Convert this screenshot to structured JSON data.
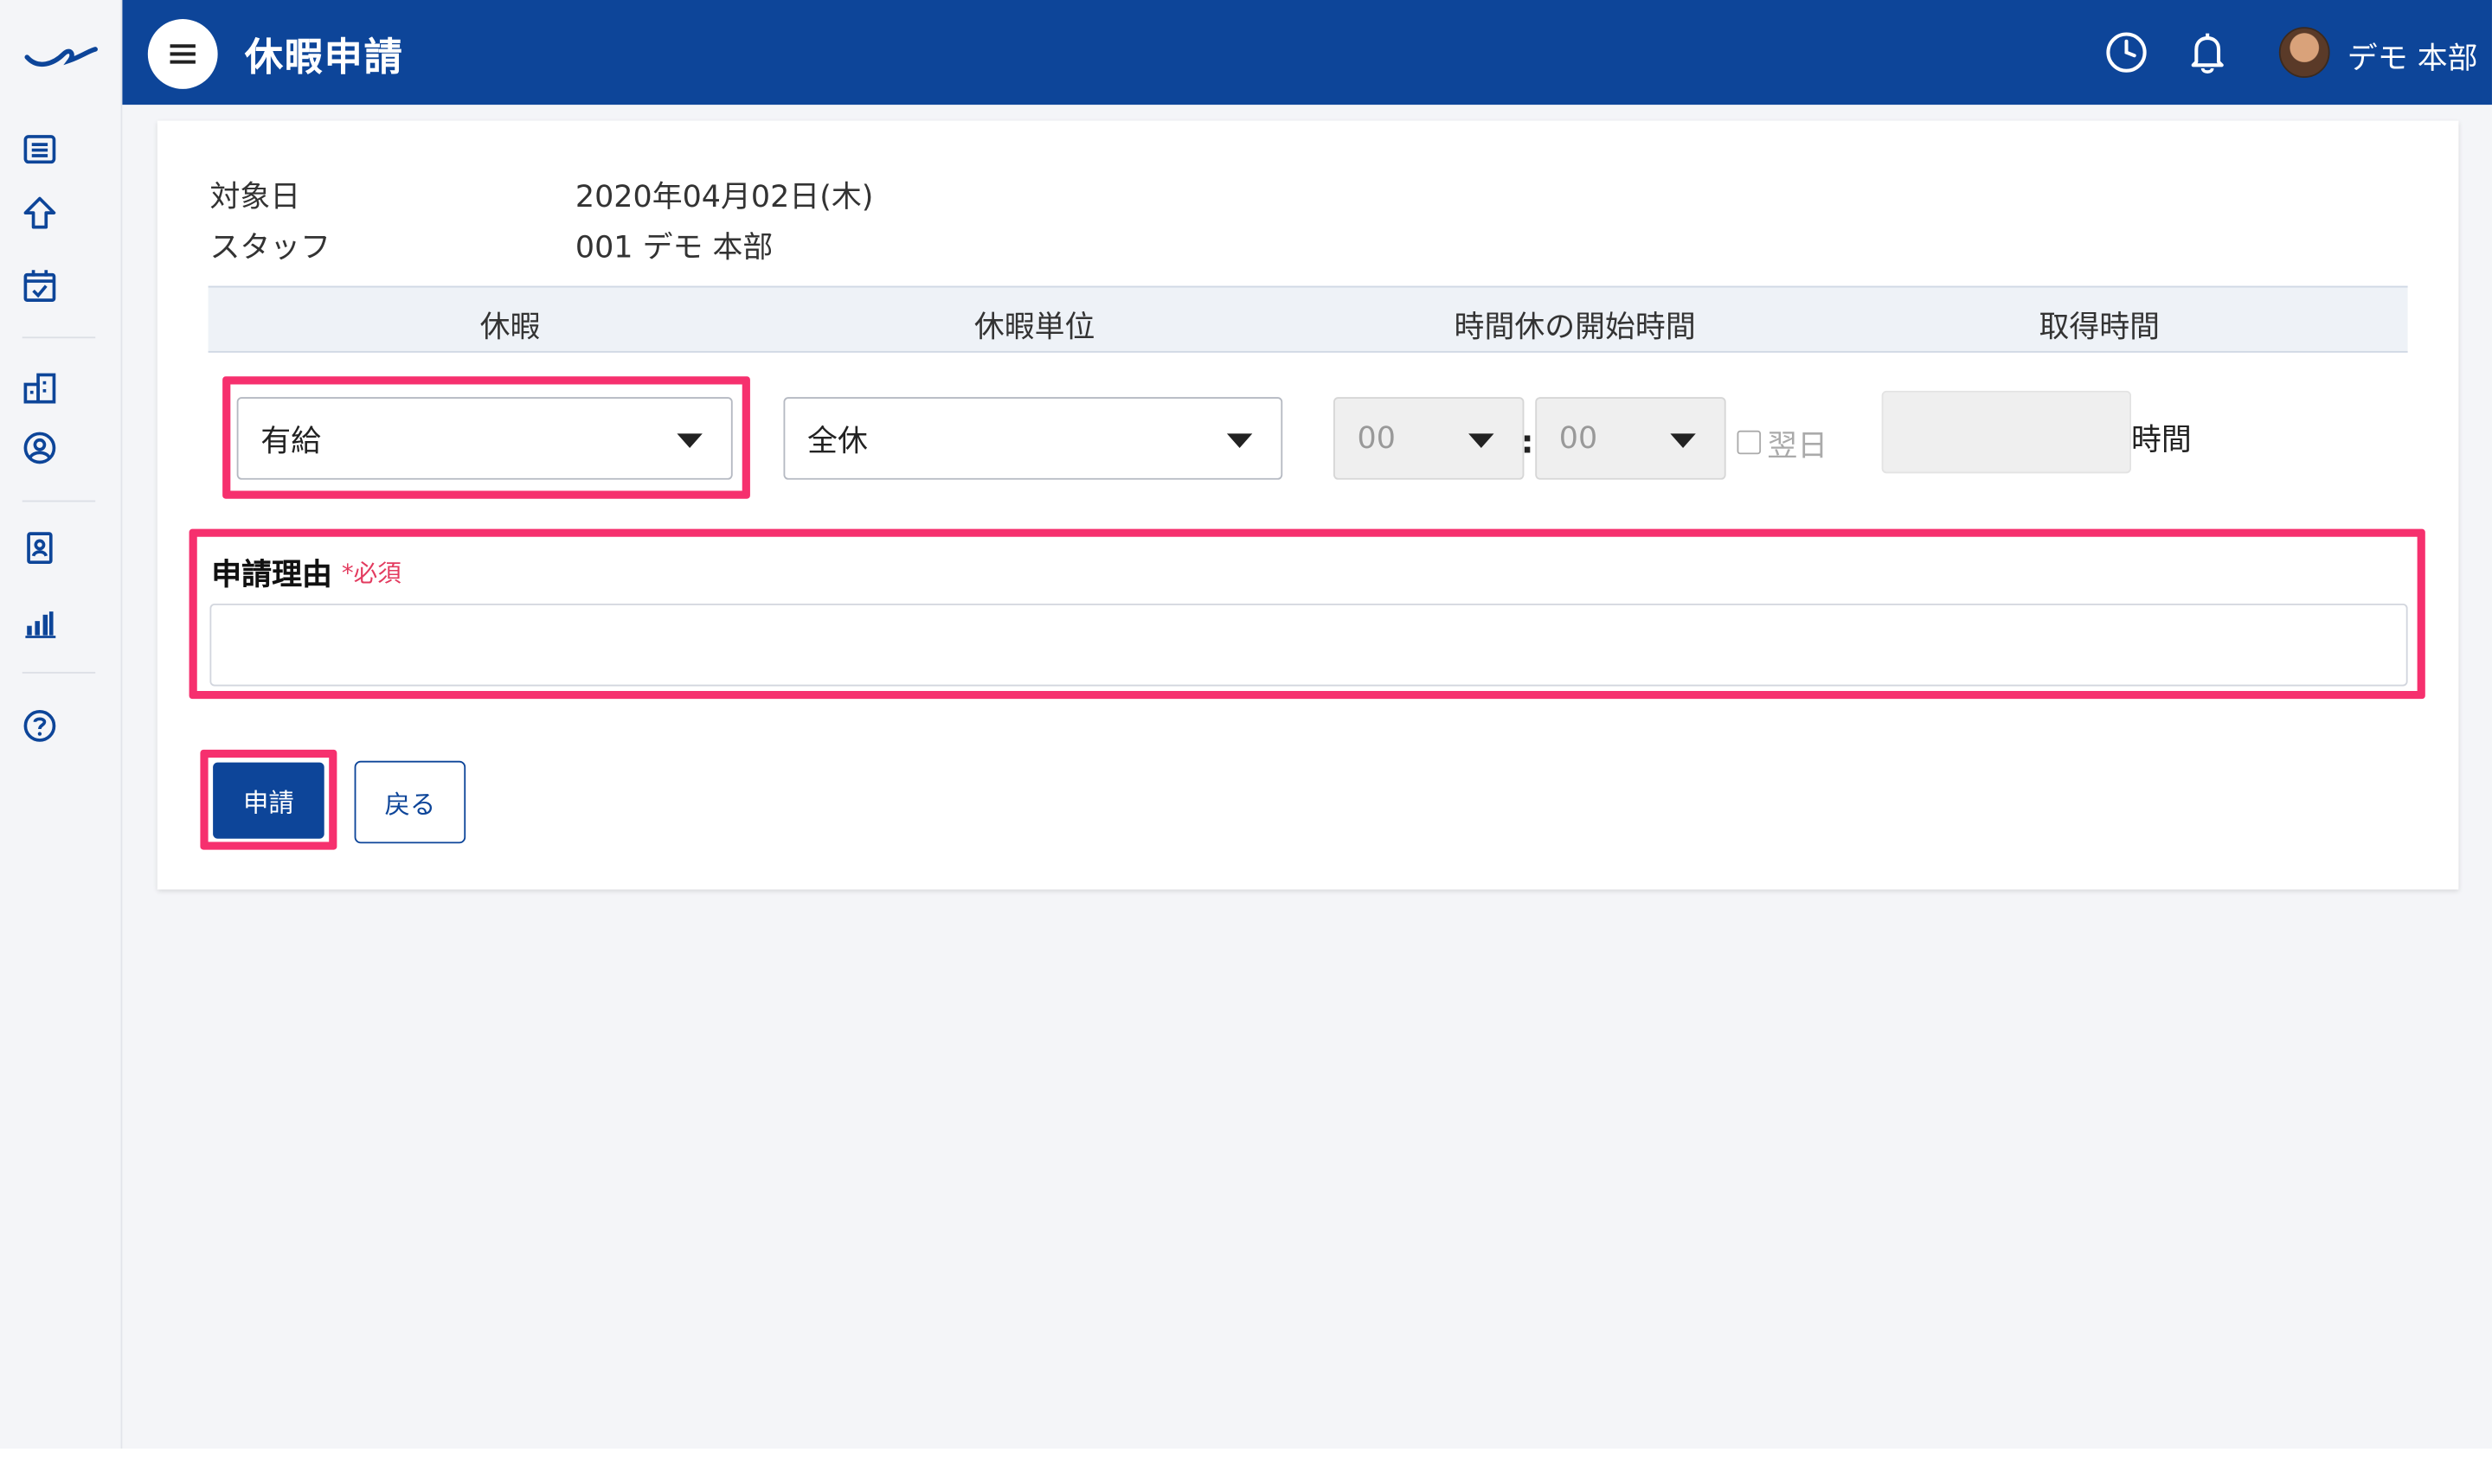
{
  "header": {
    "title": "休暇申請",
    "user_name": "デモ 本部"
  },
  "info": {
    "date_label": "対象日",
    "date_value": "2020年04月02日(木)",
    "staff_label": "スタッフ",
    "staff_value": "001 デモ 本部"
  },
  "table": {
    "headers": [
      "休暇",
      "休暇単位",
      "時間休の開始時間",
      "取得時間"
    ]
  },
  "form": {
    "leave_type": "有給",
    "leave_unit": "全休",
    "start_hour": "00",
    "start_minute": "00",
    "colon": ":",
    "next_day_label": "翌日",
    "hours_unit": "時間",
    "reason_label": "申請理由",
    "required_mark": "*必須"
  },
  "buttons": {
    "submit": "申請",
    "back": "戻る"
  },
  "colors": {
    "brand": "#0d4599",
    "highlight": "#f6306e",
    "required": "#e33b5f"
  },
  "icons": {
    "sidebar": [
      "list-icon",
      "home-icon",
      "calendar-check-icon",
      "building-icon",
      "user-circle-icon",
      "id-card-icon",
      "bar-chart-icon",
      "help-icon"
    ],
    "topbar": [
      "menu-icon",
      "clock-icon",
      "bell-icon"
    ]
  }
}
